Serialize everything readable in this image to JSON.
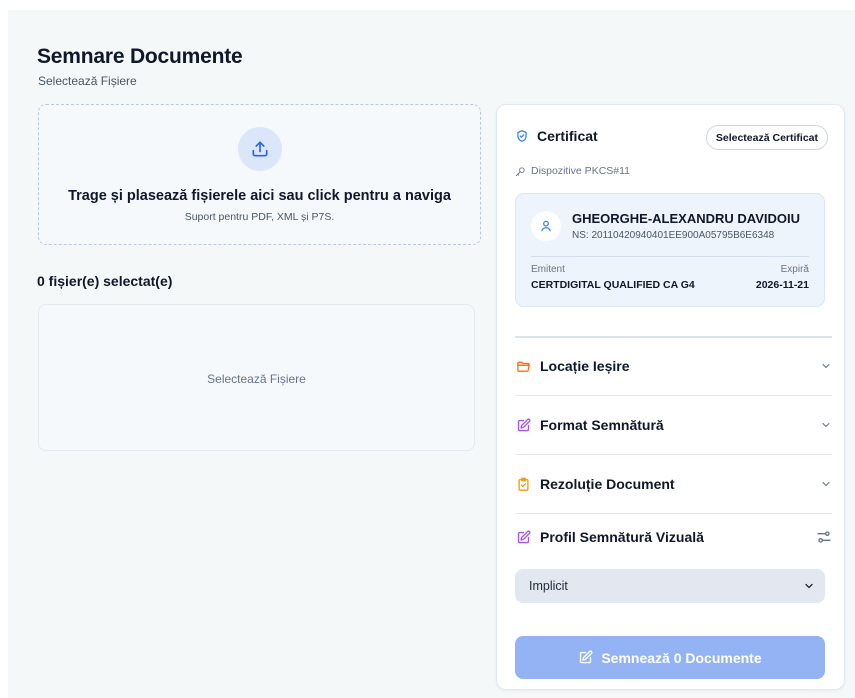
{
  "header": {
    "title": "Semnare Documente",
    "subtitle": "Selectează Fișiere"
  },
  "dropzone": {
    "icon": "upload-icon",
    "main_text": "Trage și plasează fișierele aici sau click pentru a naviga",
    "sub_text": "Suport pentru PDF, XML și P7S."
  },
  "files": {
    "count_label": "0 fișier(e) selectat(e)",
    "empty_text": "Selectează Fișiere"
  },
  "certificate": {
    "title": "Certificat",
    "select_button": "Selectează Certificat",
    "devices_label": "Dispozitive PKCS#11",
    "holder_name": "GHEORGHE-ALEXANDRU DAVIDOIU",
    "serial": "NS: 20110420940401EE900A05795B6E6348",
    "issuer_label": "Emitent",
    "issuer_value": "CERTDIGITAL QUALIFIED CA G4",
    "expiry_label": "Expiră",
    "expiry_value": "2026-11-21"
  },
  "sections": {
    "output_location": "Locație Ieșire",
    "signature_format": "Format Semnătură",
    "document_resolution": "Rezoluție Document",
    "visual_profile": "Profil Semnătură Vizuală"
  },
  "profile_select": {
    "value": "Implicit"
  },
  "sign_button": {
    "label": "Semnează 0 Documente"
  },
  "colors": {
    "accent_blue": "#3b82f6",
    "folder_orange": "#f97316",
    "format_purple": "#a855f7",
    "resolution_amber": "#f59e0b",
    "sign_button_disabled": "#93b3f5"
  }
}
